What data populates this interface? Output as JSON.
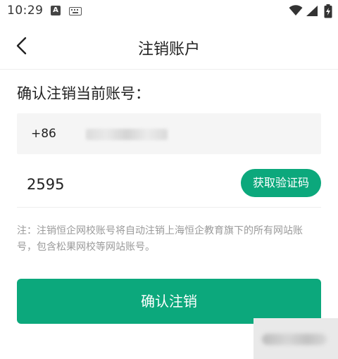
{
  "status_bar": {
    "time": "10:29",
    "a_icon_glyph": "A"
  },
  "header": {
    "title": "注销账户"
  },
  "section": {
    "heading": "确认注销当前账号："
  },
  "phone": {
    "country_code": "+86"
  },
  "code": {
    "value": "2595",
    "button_label": "获取验证码"
  },
  "note": {
    "text": "注：注销恒企网校账号将自动注销上海恒企教育旗下的所有网站账号，包含松果网校等网站账号。"
  },
  "confirm": {
    "label": "确认注销"
  },
  "colors": {
    "accent": "#0ca87c",
    "note_text": "#9a9a9a"
  },
  "icons": {
    "back": "chevron-left-icon",
    "wifi": "wifi-icon",
    "signal": "signal-icon",
    "battery": "battery-charging-icon",
    "keyboard": "keyboard-icon"
  }
}
